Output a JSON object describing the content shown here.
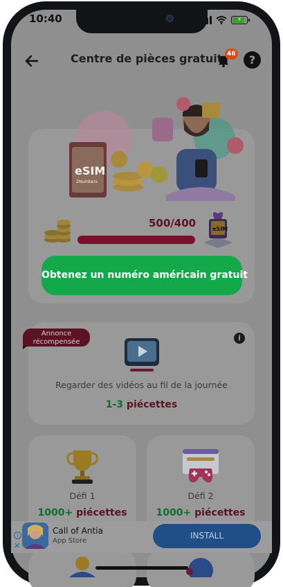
{
  "status_bar": {
    "time": "10:40"
  },
  "header": {
    "title": "Centre de pièces gratuit",
    "notification_count": "46",
    "help_label": "?"
  },
  "hero": {
    "esim_label": "eSIM",
    "esim_sub": "2Numbers",
    "gift_label": "eSIM",
    "progress_text": "500/400",
    "progress_fraction": 1.0,
    "cta_label": "Obtenez un numéro américain gratuit"
  },
  "video_card": {
    "ribbon_line1": "Annonce",
    "ribbon_line2": "récompensée",
    "info_label": "i",
    "title": "Regarder des vidéos au fil de la journée",
    "reward_range": "1-3",
    "reward_unit": " piécettes"
  },
  "challenges": [
    {
      "label": "Défi 1",
      "reward_amount": "1000+",
      "reward_unit": " piécettes"
    },
    {
      "label": "Défi 2",
      "reward_amount": "1000+",
      "reward_unit": " piécettes"
    }
  ],
  "ad": {
    "title": "Call of Antia",
    "subtitle": "App Store",
    "install_label": "INSTALL",
    "info_label": "i",
    "close_label": "✕"
  },
  "colors": {
    "accent_green": "#13a84a",
    "maroon": "#5a1224",
    "ad_button": "#1f4f86"
  },
  "icons": [
    "back-arrow-icon",
    "bell-icon",
    "help-icon",
    "coins-icon",
    "gift-icon",
    "info-icon",
    "play-video-icon",
    "trophy-icon",
    "gamepad-icon"
  ]
}
